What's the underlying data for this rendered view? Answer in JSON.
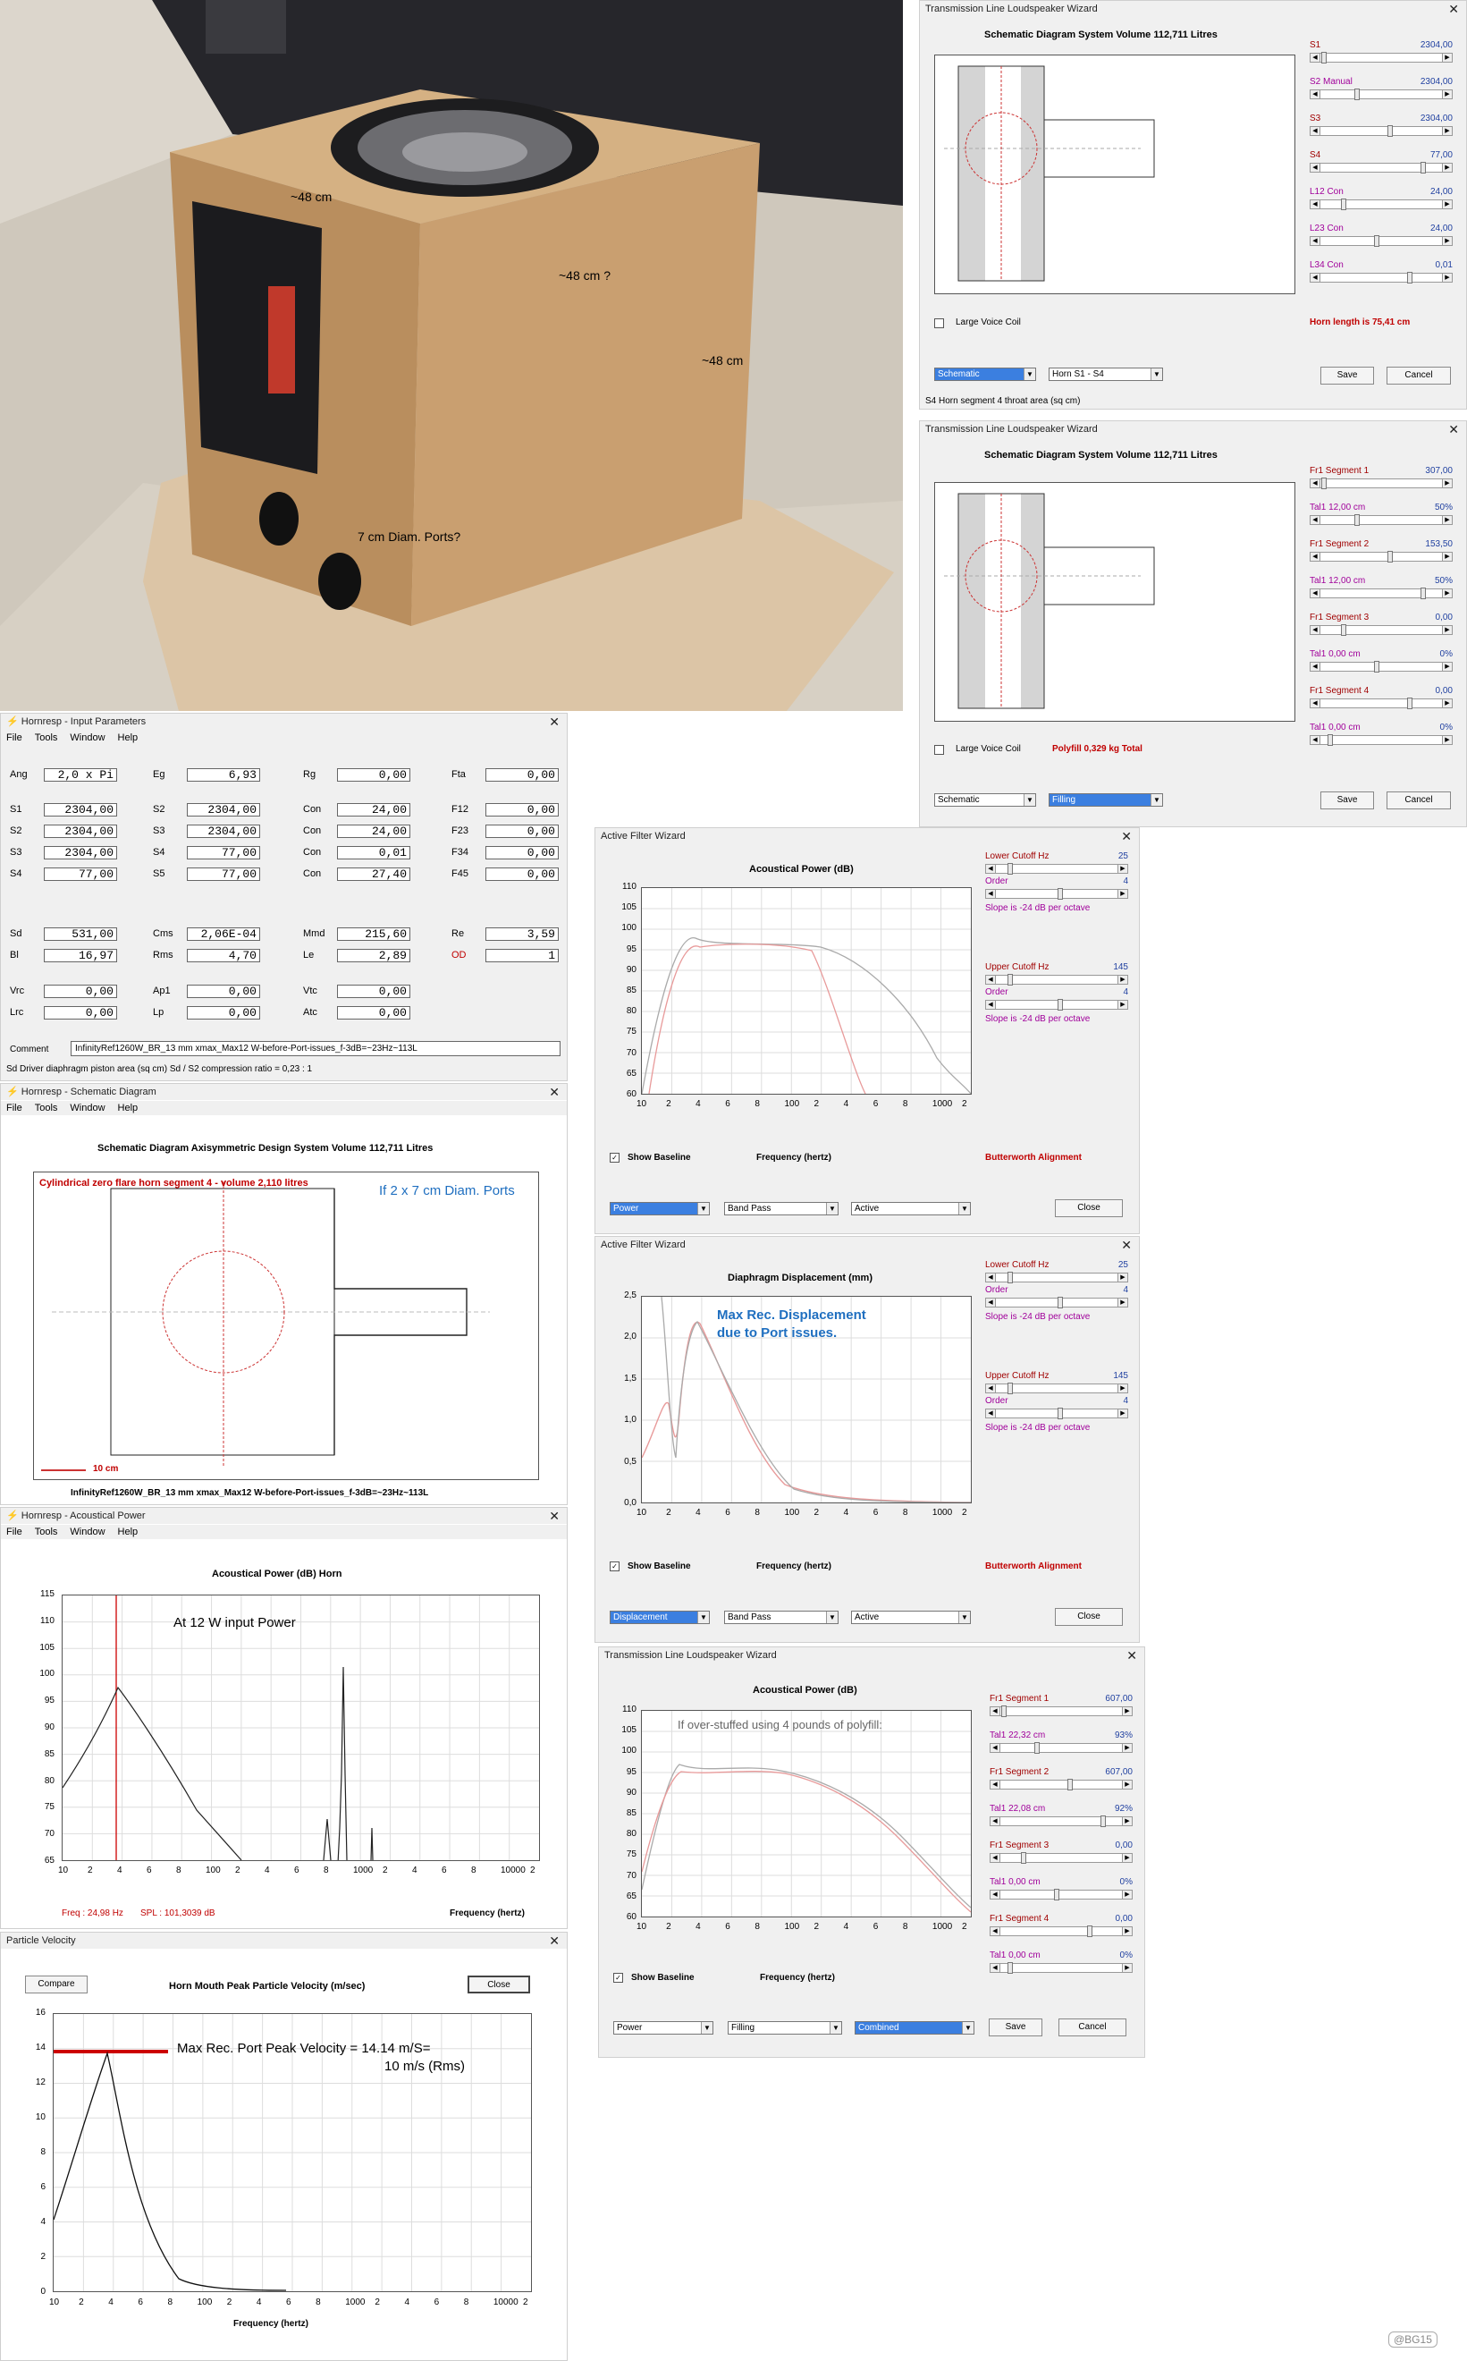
{
  "photo": {
    "labels": {
      "top": "~48 cm",
      "side": "~48 cm   ?",
      "right": "~48 cm",
      "ports": "7 cm Diam. Ports?"
    },
    "colors": {
      "floor": "#d9d2c7",
      "wall": "#c9c1b5",
      "box": "#c79f73",
      "box_front": "#b78b5c",
      "cabinet": "#2a2a2e",
      "towel": "#d8c2a6"
    }
  },
  "tl1": {
    "title": "Transmission Line Loudspeaker Wizard",
    "plot_title": "Schematic Diagram   System Volume 112,711 Litres",
    "sliders": [
      {
        "label": "S1",
        "value": "2304,00"
      },
      {
        "label": "S2  Manual",
        "value": "2304,00"
      },
      {
        "label": "S3",
        "value": "2304,00"
      },
      {
        "label": "S4",
        "value": "77,00"
      },
      {
        "label": "L12  Con",
        "value": "24,00"
      },
      {
        "label": "L23  Con",
        "value": "24,00"
      },
      {
        "label": "L34  Con",
        "value": "0,01"
      }
    ],
    "large_voice_coil": "Large Voice Coil",
    "horn_length": "Horn length is 75,41 cm",
    "dropdown1": "Schematic",
    "dropdown2": "Horn S1 - S4",
    "save": "Save",
    "cancel": "Cancel",
    "status": "S4   Horn segment 4 throat area  (sq cm)"
  },
  "tl2": {
    "title": "Transmission Line Loudspeaker Wizard",
    "plot_title": "Schematic Diagram   System Volume 112,711 Litres",
    "sliders": [
      {
        "label": "Fr1  Segment 1",
        "value": "307,00"
      },
      {
        "label": "Tal1  12,00 cm",
        "value": "50%"
      },
      {
        "label": "Fr1  Segment 2",
        "value": "153,50"
      },
      {
        "label": "Tal1  12,00 cm",
        "value": "50%"
      },
      {
        "label": "Fr1  Segment 3",
        "value": "0,00"
      },
      {
        "label": "Tal1  0,00 cm",
        "value": "0%"
      },
      {
        "label": "Fr1  Segment 4",
        "value": "0,00"
      },
      {
        "label": "Tal1  0,00 cm",
        "value": "0%"
      }
    ],
    "large_voice_coil": "Large Voice Coil",
    "polyfill": "Polyfill   0,329 kg   Total",
    "dropdown1": "Schematic",
    "dropdown2": "Filling",
    "save": "Save",
    "cancel": "Cancel"
  },
  "input": {
    "title": "Hornresp - Input Parameters",
    "menu": [
      "File",
      "Tools",
      "Window",
      "Help"
    ],
    "rows1": [
      [
        {
          "l": "Ang",
          "v": "2,0 x Pi"
        },
        {
          "l": "Eg",
          "v": "6,93"
        },
        {
          "l": "Rg",
          "v": "0,00"
        },
        {
          "l": "Fta",
          "v": "0,00"
        }
      ]
    ],
    "rows2": [
      [
        {
          "l": "S1",
          "v": "2304,00"
        },
        {
          "l": "S2",
          "v": "2304,00"
        },
        {
          "l": "Con",
          "v": "24,00"
        },
        {
          "l": "F12",
          "v": "0,00"
        }
      ],
      [
        {
          "l": "S2",
          "v": "2304,00"
        },
        {
          "l": "S3",
          "v": "2304,00"
        },
        {
          "l": "Con",
          "v": "24,00"
        },
        {
          "l": "F23",
          "v": "0,00"
        }
      ],
      [
        {
          "l": "S3",
          "v": "2304,00"
        },
        {
          "l": "S4",
          "v": "77,00"
        },
        {
          "l": "Con",
          "v": "0,01"
        },
        {
          "l": "F34",
          "v": "0,00"
        }
      ],
      [
        {
          "l": "S4",
          "v": "77,00"
        },
        {
          "l": "S5",
          "v": "77,00"
        },
        {
          "l": "Con",
          "v": "27,40"
        },
        {
          "l": "F45",
          "v": "0,00"
        }
      ]
    ],
    "rows3": [
      [
        {
          "l": "Sd",
          "v": "531,00"
        },
        {
          "l": "Cms",
          "v": "2,06E-04"
        },
        {
          "l": "Mmd",
          "v": "215,60"
        },
        {
          "l": "Re",
          "v": "3,59"
        }
      ],
      [
        {
          "l": "Bl",
          "v": "16,97"
        },
        {
          "l": "Rms",
          "v": "4,70"
        },
        {
          "l": "Le",
          "v": "2,89"
        },
        {
          "l": "OD",
          "v": "1"
        }
      ]
    ],
    "rows4": [
      [
        {
          "l": "Vrc",
          "v": "0,00"
        },
        {
          "l": "Ap1",
          "v": "0,00"
        },
        {
          "l": "Vtc",
          "v": "0,00"
        }
      ],
      [
        {
          "l": "Lrc",
          "v": "0,00"
        },
        {
          "l": "Lp",
          "v": "0,00"
        },
        {
          "l": "Atc",
          "v": "0,00"
        }
      ]
    ],
    "comment_label": "Comment",
    "comment": "InfinityRef1260W_BR_13 mm xmax_Max12 W-before-Port-issues_f-3dB=~23Hz~113L",
    "status": "Sd   Driver diaphragm piston area  (sq cm)    Sd / S2 compression ratio = 0,23 : 1"
  },
  "schem": {
    "title": "Hornresp - Schematic Diagram",
    "menu": [
      "File",
      "Tools",
      "Window",
      "Help"
    ],
    "plot_title": "Schematic Diagram   Axisymmetric Design   System Volume 112,711 Litres",
    "red_note": "Cylindrical zero flare horn segment 4 - volume 2,110 litres",
    "blue_note": "If 2 x 7 cm Diam. Ports",
    "scale": "10 cm",
    "caption": "InfinityRef1260W_BR_13 mm xmax_Max12 W-before-Port-issues_f-3dB=~23Hz~113L"
  },
  "acoustic": {
    "title": "Hornresp - Acoustical Power",
    "menu": [
      "File",
      "Tools",
      "Window",
      "Help"
    ],
    "plot_title": "Acoustical Power (dB)   Horn",
    "annotation": "At 12 W input Power",
    "freq": "Freq : 24,98 Hz",
    "spl": "SPL : 101,3039 dB",
    "xlabel": "Frequency (hertz)",
    "yticks": [
      "115",
      "110",
      "105",
      "100",
      "95",
      "90",
      "85",
      "80",
      "75",
      "70",
      "65"
    ],
    "xticks": [
      "10",
      "2",
      "4",
      "6",
      "8",
      "100",
      "2",
      "4",
      "6",
      "8",
      "1000",
      "2",
      "4",
      "6",
      "8",
      "10000",
      "2"
    ]
  },
  "particle": {
    "title": "Particle Velocity",
    "compare": "Compare",
    "close": "Close",
    "plot_title": "Horn Mouth Peak Particle Velocity (m/sec)",
    "ann1": "Max Rec. Port Peak Velocity = 14.14 m/S=",
    "ann2": "10 m/s (Rms)",
    "xlabel": "Frequency (hertz)",
    "yticks": [
      "16",
      "14",
      "12",
      "10",
      "8",
      "6",
      "4",
      "2",
      "0"
    ],
    "xticks": [
      "10",
      "2",
      "4",
      "6",
      "8",
      "100",
      "2",
      "4",
      "6",
      "8",
      "1000",
      "2",
      "4",
      "6",
      "8",
      "10000",
      "2"
    ]
  },
  "af1": {
    "title": "Active Filter Wizard",
    "plot_title": "Acoustical Power (dB)",
    "lower": {
      "label": "Lower Cutoff  Hz",
      "value": "25",
      "order_label": "Order",
      "order": "4",
      "slope": "Slope is -24 dB per octave"
    },
    "upper": {
      "label": "Upper Cutoff  Hz",
      "value": "145",
      "order_label": "Order",
      "order": "4",
      "slope": "Slope is -24 dB per octave"
    },
    "show_baseline": "Show Baseline",
    "xlabel": "Frequency (hertz)",
    "alignment": "Butterworth Alignment",
    "yticks": [
      "110",
      "105",
      "100",
      "95",
      "90",
      "85",
      "80",
      "75",
      "70",
      "65",
      "60"
    ],
    "xticks": [
      "10",
      "2",
      "4",
      "6",
      "8",
      "100",
      "2",
      "4",
      "6",
      "8",
      "1000",
      "2"
    ],
    "dd": [
      "Power",
      "Band Pass",
      "Active"
    ],
    "close": "Close"
  },
  "af2": {
    "title": "Active Filter Wizard",
    "plot_title": "Diaphragm Displacement (mm)",
    "annotation1": "Max Rec. Displacement",
    "annotation2": "due to Port issues.",
    "lower": {
      "label": "Lower Cutoff  Hz",
      "value": "25",
      "order_label": "Order",
      "order": "4",
      "slope": "Slope is -24 dB per octave"
    },
    "upper": {
      "label": "Upper Cutoff  Hz",
      "value": "145",
      "order_label": "Order",
      "order": "4",
      "slope": "Slope is -24 dB per octave"
    },
    "show_baseline": "Show Baseline",
    "xlabel": "Frequency (hertz)",
    "alignment": "Butterworth Alignment",
    "yticks": [
      "2,5",
      "2,0",
      "1,5",
      "1,0",
      "0,5",
      "0,0"
    ],
    "xticks": [
      "10",
      "2",
      "4",
      "6",
      "8",
      "100",
      "2",
      "4",
      "6",
      "8",
      "1000",
      "2"
    ],
    "dd": [
      "Displacement",
      "Band Pass",
      "Active"
    ],
    "close": "Close"
  },
  "tl3": {
    "title": "Transmission Line Loudspeaker Wizard",
    "plot_title": "Acoustical Power (dB)",
    "annotation": "If over-stuffed using 4 pounds of polyfill:",
    "sliders": [
      {
        "label": "Fr1  Segment 1",
        "value": "607,00"
      },
      {
        "label": "Tal1  22,32 cm",
        "value": "93%"
      },
      {
        "label": "Fr1  Segment 2",
        "value": "607,00"
      },
      {
        "label": "Tal1  22,08 cm",
        "value": "92%"
      },
      {
        "label": "Fr1  Segment 3",
        "value": "0,00"
      },
      {
        "label": "Tal1  0,00 cm",
        "value": "0%"
      },
      {
        "label": "Fr1  Segment 4",
        "value": "0,00"
      },
      {
        "label": "Tal1  0,00 cm",
        "value": "0%"
      }
    ],
    "show_baseline": "Show Baseline",
    "xlabel": "Frequency (hertz)",
    "yticks": [
      "110",
      "105",
      "100",
      "95",
      "90",
      "85",
      "80",
      "75",
      "70",
      "65",
      "60"
    ],
    "xticks": [
      "10",
      "2",
      "4",
      "6",
      "8",
      "100",
      "2",
      "4",
      "6",
      "8",
      "1000",
      "2"
    ],
    "dd": [
      "Power",
      "Filling",
      "Combined"
    ],
    "save": "Save",
    "cancel": "Cancel"
  },
  "watermark": "@BG15"
}
